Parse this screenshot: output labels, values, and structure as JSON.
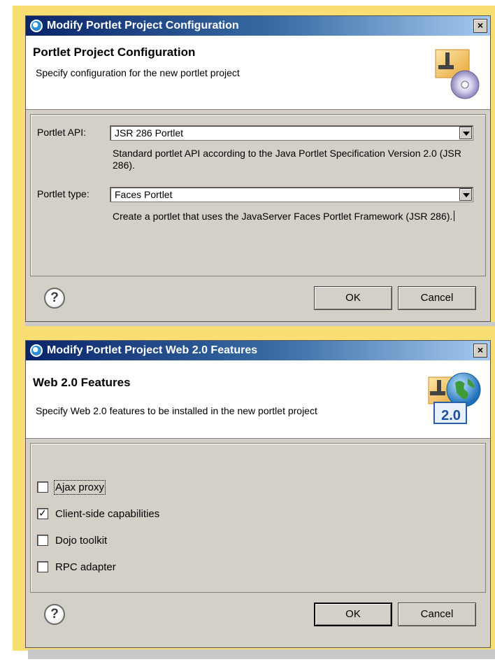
{
  "dialog1": {
    "title": "Modify Portlet Project Configuration",
    "close_icon": "×",
    "header_title": "Portlet Project Configuration",
    "header_description": "Specify configuration for the new portlet project",
    "portlet_api_label": "Portlet API:",
    "portlet_api_value": "JSR 286 Portlet",
    "portlet_api_help": "Standard portlet API according to the Java Portlet Specification Version 2.0 (JSR 286).",
    "portlet_type_label": "Portlet type:",
    "portlet_type_value": "Faces Portlet",
    "portlet_type_help": "Create a portlet that uses the JavaServer Faces Portlet Framework (JSR 286).",
    "help_symbol": "?",
    "ok_label": "OK",
    "cancel_label": "Cancel"
  },
  "dialog2": {
    "title": "Modify Portlet Project Web 2.0 Features",
    "close_icon": "×",
    "header_title": "Web 2.0 Features",
    "header_description": "Specify Web 2.0 features to be installed in the new portlet project",
    "banner_badge": "2.0",
    "features": [
      {
        "label": "Ajax proxy",
        "checked": false
      },
      {
        "label": "Client-side capabilities",
        "checked": true
      },
      {
        "label": "Dojo toolkit",
        "checked": false
      },
      {
        "label": "RPC adapter",
        "checked": false
      }
    ],
    "help_symbol": "?",
    "ok_label": "OK",
    "cancel_label": "Cancel"
  },
  "icons": {
    "app": "eclipse-icon",
    "help": "help-icon",
    "banner1": "portlet-config-wizard-icon",
    "banner2": "web20-globe-icon"
  },
  "colors": {
    "titlebar_start": "#0a246a",
    "titlebar_end": "#a6caf0",
    "dialog_bg": "#d4d0c8",
    "backdrop": "#f9df73"
  }
}
